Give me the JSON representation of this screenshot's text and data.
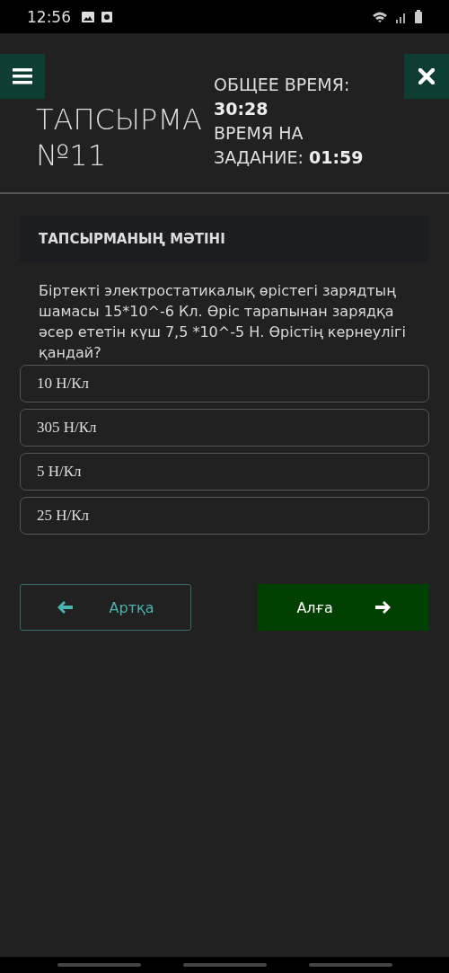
{
  "status_bar": {
    "time": "12:56"
  },
  "header": {
    "title": "ТАПСЫРМА №11",
    "total_time_label": "ОБЩЕЕ ВРЕМЯ:",
    "total_time": "30:28",
    "task_time_label": "ВРЕМЯ НА ЗАДАНИЕ:",
    "task_time": "01:59"
  },
  "section": {
    "heading": "ТАПСЫРМАНЫҢ МӘТІНІ",
    "question": "Біртекті электростатикалық өрістегі зарядтың шамасы 15*10^-6 Кл. Өріс тарапынан зарядқа әсер ететін күш 7,5 *10^-5 Н. Өрістің кернеулігі қандай?"
  },
  "options": [
    {
      "label": "10 Н/Кл"
    },
    {
      "label": "305 Н/Кл"
    },
    {
      "label": "5 Н/Кл"
    },
    {
      "label": "25 Н/Кл"
    }
  ],
  "buttons": {
    "back": "Артқа",
    "next": "Алға"
  }
}
